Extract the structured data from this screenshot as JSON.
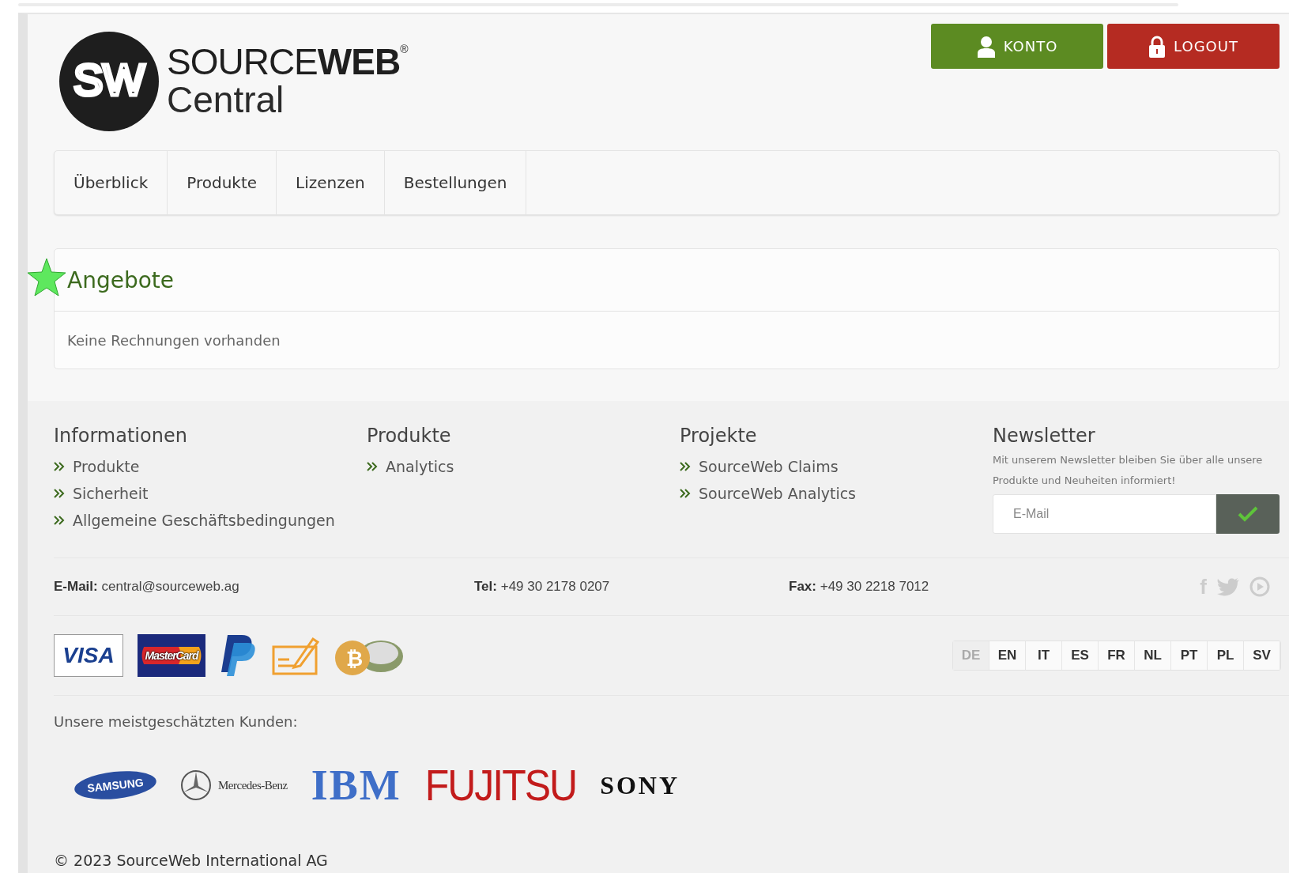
{
  "logo": {
    "mark": "SW",
    "name_light": "SOURCE",
    "name_bold": "WEB",
    "registered": "®",
    "subtitle": "Central"
  },
  "header_buttons": [
    {
      "kind": "account",
      "label": "KONTO"
    },
    {
      "kind": "logout",
      "label": "LOGOUT"
    }
  ],
  "nav": [
    {
      "label": "Überblick"
    },
    {
      "label": "Produkte"
    },
    {
      "label": "Lizenzen"
    },
    {
      "label": "Bestellungen"
    }
  ],
  "offers_panel": {
    "title": "Angebote",
    "body": "Keine Rechnungen vorhanden"
  },
  "footer_columns": [
    {
      "title": "Informationen",
      "links": [
        "Produkte",
        "Sicherheit",
        "Allgemeine Geschäftsbedingungen"
      ]
    },
    {
      "title": "Produkte",
      "links": [
        "Analytics"
      ]
    },
    {
      "title": "Projekte",
      "links": [
        "SourceWeb Claims",
        "SourceWeb Analytics"
      ]
    }
  ],
  "newsletter": {
    "title": "Newsletter",
    "text": "Mit unserem Newsletter bleiben Sie über alle unsere Produkte und Neuheiten informiert!",
    "placeholder": "E-Mail"
  },
  "contact": [
    {
      "label": "E-Mail:",
      "value": "central@sourceweb.ag"
    },
    {
      "label": "Tel:",
      "value": "+49 30 2178 0207"
    },
    {
      "label": "Fax:",
      "value": "+49 30 2218 7012"
    }
  ],
  "social": [
    {
      "kind": "facebook",
      "label": "f"
    },
    {
      "kind": "twitter"
    },
    {
      "kind": "play"
    }
  ],
  "payments": [
    {
      "kind": "visa",
      "label": "VISA"
    },
    {
      "kind": "mastercard",
      "label": "MasterCard"
    },
    {
      "kind": "paypal"
    },
    {
      "kind": "cheque"
    },
    {
      "kind": "bitcoin",
      "label": "₿"
    }
  ],
  "languages": [
    {
      "label": "DE",
      "selected": true
    },
    {
      "label": "EN",
      "selected": false
    },
    {
      "label": "IT",
      "selected": false
    },
    {
      "label": "ES",
      "selected": false
    },
    {
      "label": "FR",
      "selected": false
    },
    {
      "label": "NL",
      "selected": false
    },
    {
      "label": "PT",
      "selected": false
    },
    {
      "label": "PL",
      "selected": false
    },
    {
      "label": "SV",
      "selected": false
    }
  ],
  "customers": {
    "title": "Unsere meistgeschätzten Kunden:",
    "logos": [
      {
        "kind": "samsung",
        "label": "SAMSUNG"
      },
      {
        "kind": "mercedes",
        "label": "Mercedes-Benz"
      },
      {
        "kind": "ibm",
        "label": "IBM"
      },
      {
        "kind": "fujitsu",
        "label": "FUJITSU"
      },
      {
        "kind": "sony",
        "label": "SONY"
      }
    ]
  },
  "copyright": "© 2023 SourceWeb International AG"
}
